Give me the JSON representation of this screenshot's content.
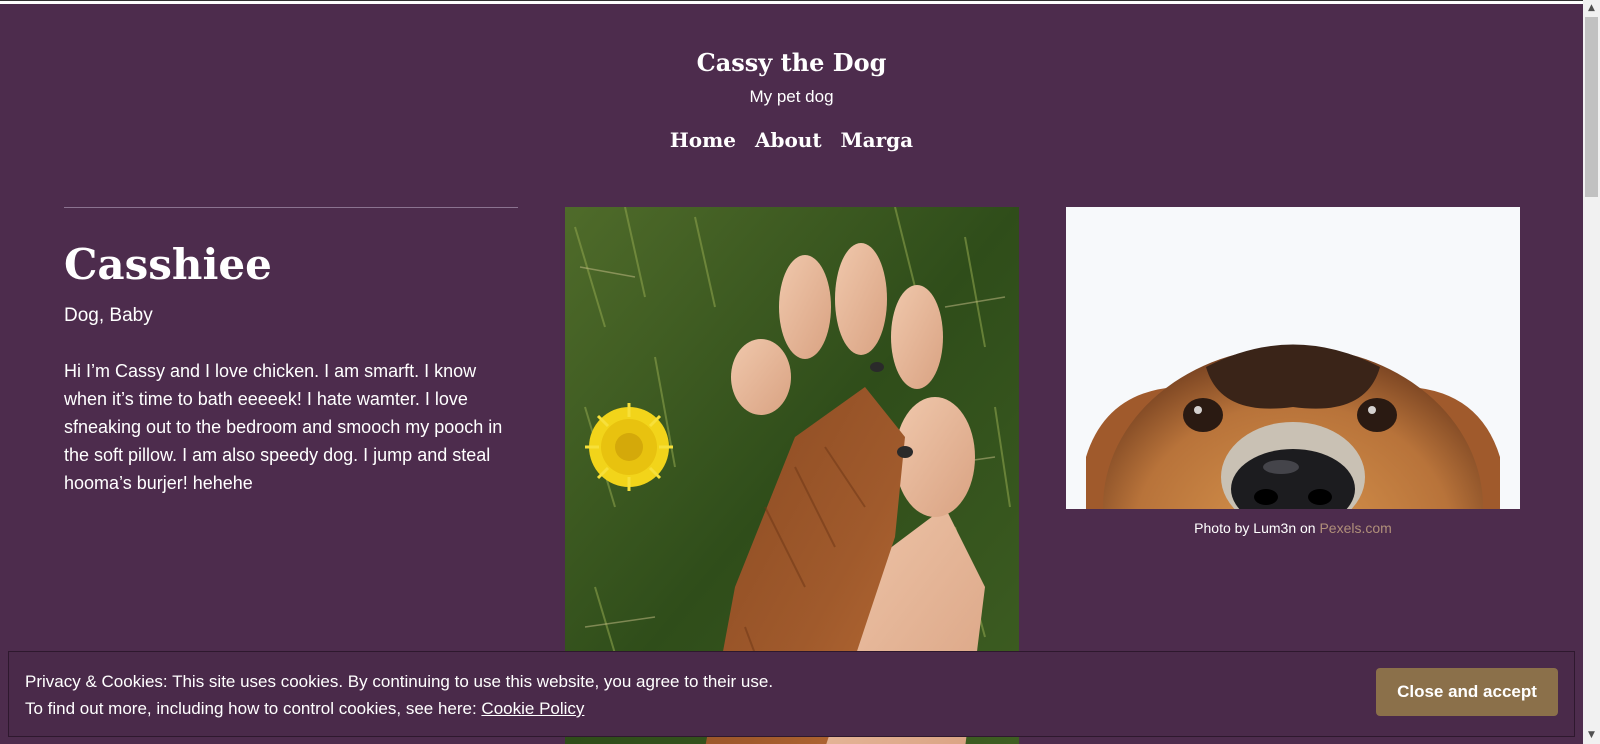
{
  "site": {
    "title": "Cassy the Dog",
    "tagline": "My pet dog"
  },
  "nav": {
    "items": [
      {
        "label": "Home"
      },
      {
        "label": "About"
      },
      {
        "label": "Marga"
      }
    ]
  },
  "post": {
    "title": "Casshiee",
    "meta": "Dog, Baby",
    "content": "Hi I’m Cassy and I love chicken. I am smarft. I know when it’s time to bath eeeeek! I hate wamter. I love sfneaking out to the bedroom and smooch my pooch in the soft pillow. I am also speedy dog. I jump and steal hooma’s burjer! hehehe"
  },
  "photo_caption": {
    "prefix": "Photo by Lum3n on ",
    "link": "Pexels.com"
  },
  "cookie_notice": {
    "line1": "Privacy & Cookies: This site uses cookies. By continuing to use this website, you agree to their use.",
    "line2_prefix": "To find out more, including how to control cookies, see here: ",
    "policy_link": "Cookie Policy",
    "accept_label": "Close and accept"
  },
  "colors": {
    "background": "#4d2c4d",
    "accent": "#8b704a",
    "link": "#b08f7a"
  },
  "icons": [
    "scroll-up-arrow-icon",
    "scroll-down-arrow-icon"
  ]
}
